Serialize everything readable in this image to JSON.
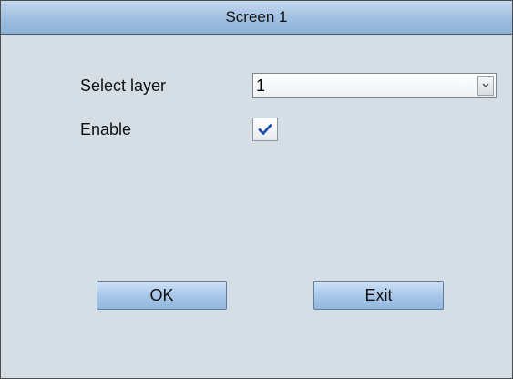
{
  "dialog": {
    "title": "Screen 1",
    "fields": {
      "select_layer_label": "Select layer",
      "select_layer_value": "1",
      "enable_label": "Enable",
      "enable_checked": true
    },
    "buttons": {
      "ok_label": "OK",
      "exit_label": "Exit"
    },
    "icons": {
      "dropdown": "chevron-down-icon",
      "checkmark": "checkmark-icon"
    },
    "colors": {
      "background": "#d5dde5",
      "titlebar": "#9fbfe0",
      "button": "#a9c8e9",
      "checkmark": "#1f4ea8"
    }
  }
}
